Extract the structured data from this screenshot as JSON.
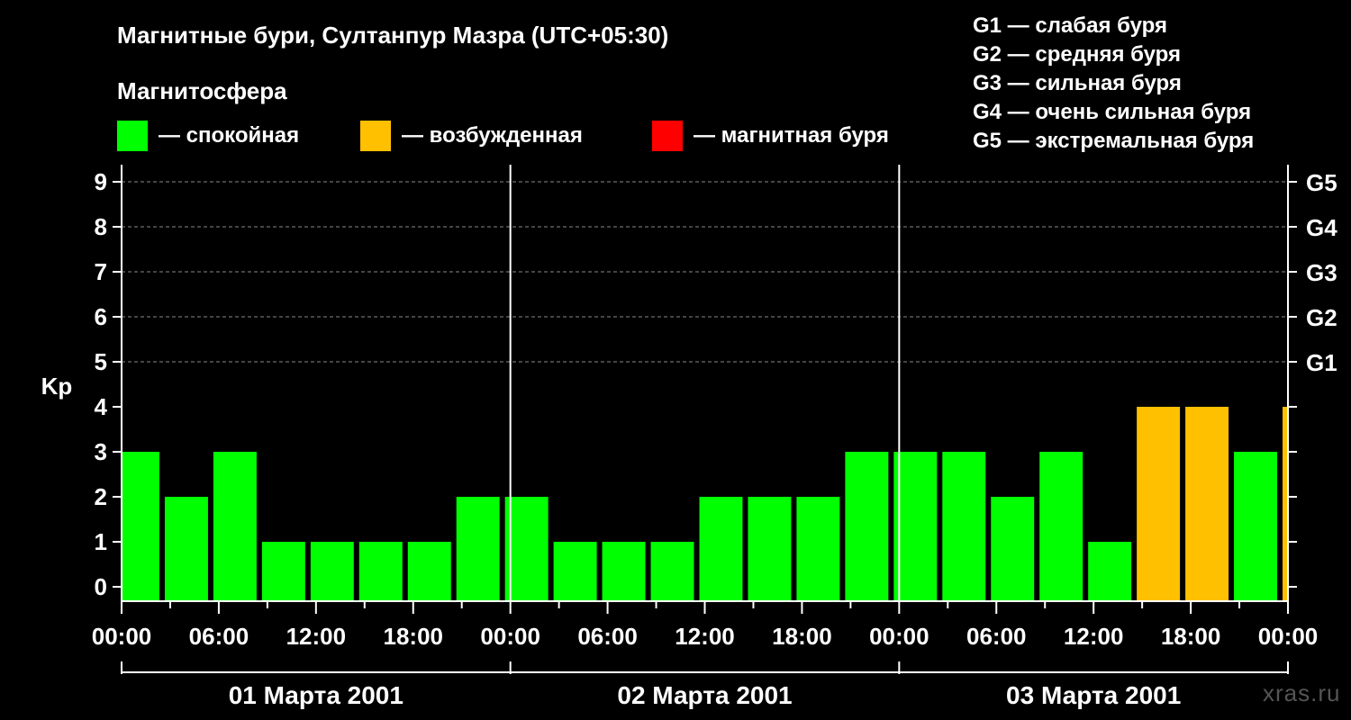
{
  "title": "Магнитные бури, Султанпур Мазра (UTC+05:30)",
  "subtitle": "Магнитосфера",
  "legend": [
    {
      "label": "— спокойная",
      "color": "#00ff00"
    },
    {
      "label": "— возбужденная",
      "color": "#ffc000"
    },
    {
      "label": "— магнитная буря",
      "color": "#ff0000"
    }
  ],
  "g_scale": [
    "G1 — слабая буря",
    "G2 — средняя буря",
    "G3 — сильная буря",
    "G4 — очень сильная буря",
    "G5 — экстремальная буря"
  ],
  "watermark": "xras.ru",
  "chart_data": {
    "type": "bar",
    "ylabel": "Kp",
    "ylim": [
      0,
      9
    ],
    "yticks": [
      0,
      1,
      2,
      3,
      4,
      5,
      6,
      7,
      8,
      9
    ],
    "right_axis_labels": [
      {
        "kp": 5,
        "label": "G1"
      },
      {
        "kp": 6,
        "label": "G2"
      },
      {
        "kp": 7,
        "label": "G3"
      },
      {
        "kp": 8,
        "label": "G4"
      },
      {
        "kp": 9,
        "label": "G5"
      }
    ],
    "grid": "horizontal dashed at Kp 5-9",
    "x_tick_labels": [
      "00:00",
      "06:00",
      "12:00",
      "18:00",
      "00:00",
      "06:00",
      "12:00",
      "18:00",
      "00:00",
      "06:00",
      "12:00",
      "18:00",
      "00:00"
    ],
    "days": [
      "01 Марта 2001",
      "02 Марта 2001",
      "03 Марта 2001"
    ],
    "bar_interval_hours": 3,
    "first_bar_start_hour": -0.5,
    "values": [
      3,
      2,
      3,
      1,
      1,
      1,
      1,
      2,
      2,
      1,
      1,
      1,
      2,
      2,
      2,
      3,
      3,
      3,
      2,
      3,
      1,
      4,
      4,
      3,
      4
    ],
    "colors": {
      "quiet": "#00ff00",
      "active": "#ffc000",
      "storm": "#ff0000"
    }
  }
}
